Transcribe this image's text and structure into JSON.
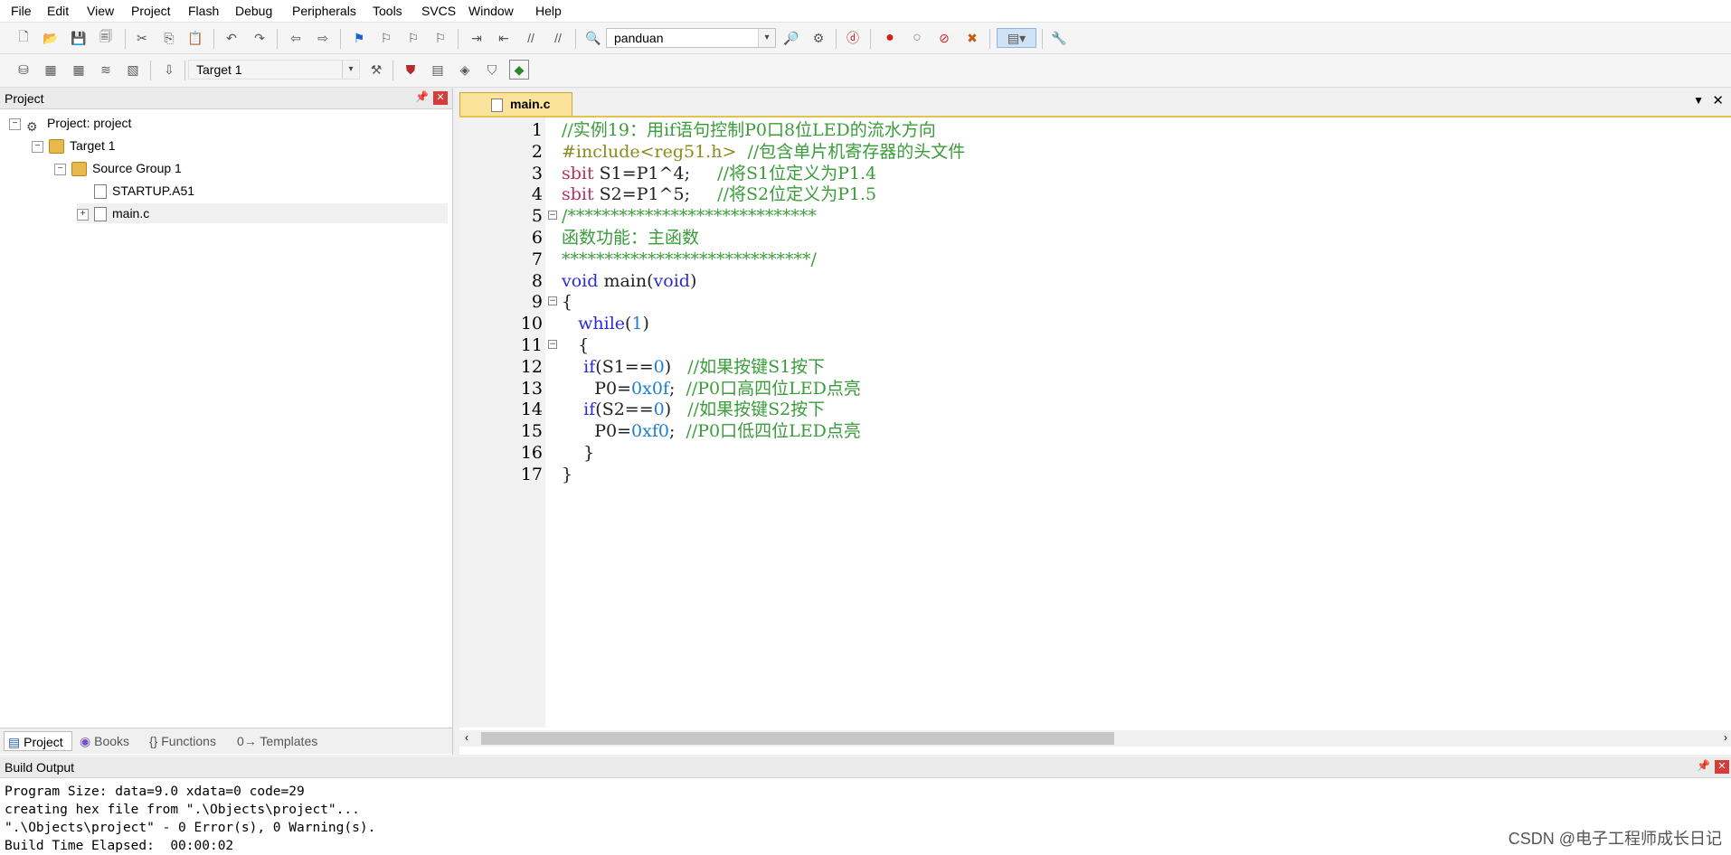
{
  "menu": [
    "File",
    "Edit",
    "View",
    "Project",
    "Flash",
    "Debug",
    "Peripherals",
    "Tools",
    "SVCS",
    "Window",
    "Help"
  ],
  "toolbar1": {
    "find_combo": "panduan"
  },
  "toolbar2": {
    "target_combo": "Target 1"
  },
  "project_panel": {
    "title": "Project",
    "tree": [
      "Project: project",
      "Target 1",
      "Source Group 1",
      "STARTUP.A51",
      "main.c"
    ],
    "bottom_tabs": [
      "Project",
      "Books",
      "{} Functions",
      "0→ Templates"
    ]
  },
  "editor": {
    "tab": "main.c",
    "lines": [
      [
        {
          "t": "c",
          "s": "//实例19：用if语句控制P0口8位LED的流水方向"
        }
      ],
      [
        {
          "t": "p",
          "s": "#include<reg51.h>"
        },
        {
          "t": "n",
          "s": "  "
        },
        {
          "t": "c",
          "s": "//包含单片机寄存器的头文件"
        }
      ],
      [
        {
          "t": "y",
          "s": "sbit"
        },
        {
          "t": "n",
          "s": " S1=P1^4;     "
        },
        {
          "t": "c",
          "s": "//将S1位定义为P1.4"
        }
      ],
      [
        {
          "t": "y",
          "s": "sbit"
        },
        {
          "t": "n",
          "s": " S2=P1^5;     "
        },
        {
          "t": "c",
          "s": "//将S2位定义为P1.5"
        }
      ],
      [
        {
          "t": "c",
          "s": "/*****************************"
        }
      ],
      [
        {
          "t": "c",
          "s": "函数功能：主函数"
        }
      ],
      [
        {
          "t": "c",
          "s": "*****************************/"
        }
      ],
      [
        {
          "t": "k",
          "s": "void"
        },
        {
          "t": "n",
          "s": " main("
        },
        {
          "t": "k",
          "s": "void"
        },
        {
          "t": "n",
          "s": ")"
        }
      ],
      [
        {
          "t": "n",
          "s": "{"
        }
      ],
      [
        {
          "t": "n",
          "s": "   "
        },
        {
          "t": "k",
          "s": "while"
        },
        {
          "t": "n",
          "s": "("
        },
        {
          "t": "d",
          "s": "1"
        },
        {
          "t": "n",
          "s": ")"
        }
      ],
      [
        {
          "t": "n",
          "s": "   {"
        }
      ],
      [
        {
          "t": "n",
          "s": "    "
        },
        {
          "t": "k",
          "s": "if"
        },
        {
          "t": "n",
          "s": "(S1=="
        },
        {
          "t": "d",
          "s": "0"
        },
        {
          "t": "n",
          "s": ")   "
        },
        {
          "t": "c",
          "s": "//如果按键S1按下"
        }
      ],
      [
        {
          "t": "n",
          "s": "      P0="
        },
        {
          "t": "d",
          "s": "0x0f"
        },
        {
          "t": "n",
          "s": ";  "
        },
        {
          "t": "c",
          "s": "//P0口高四位LED点亮"
        }
      ],
      [
        {
          "t": "n",
          "s": "    "
        },
        {
          "t": "k",
          "s": "if"
        },
        {
          "t": "n",
          "s": "(S2=="
        },
        {
          "t": "d",
          "s": "0"
        },
        {
          "t": "n",
          "s": ")   "
        },
        {
          "t": "c",
          "s": "//如果按键S2按下"
        }
      ],
      [
        {
          "t": "n",
          "s": "      P0="
        },
        {
          "t": "d",
          "s": "0xf0"
        },
        {
          "t": "n",
          "s": ";  "
        },
        {
          "t": "c",
          "s": "//P0口低四位LED点亮"
        }
      ],
      [
        {
          "t": "n",
          "s": "    }"
        }
      ],
      [
        {
          "t": "n",
          "s": "}"
        }
      ]
    ],
    "line_numbers": [
      "1",
      "2",
      "3",
      "4",
      "5",
      "6",
      "7",
      "8",
      "9",
      "10",
      "11",
      "12",
      "13",
      "14",
      "15",
      "16",
      "17"
    ],
    "fold_lines": [
      5,
      9,
      11
    ]
  },
  "build_output": {
    "title": "Build Output",
    "lines": [
      "Program Size: data=9.0 xdata=0 code=29",
      "creating hex file from \".\\Objects\\project\"...",
      "\".\\Objects\\project\" - 0 Error(s), 0 Warning(s).",
      "Build Time Elapsed:  00:00:02"
    ]
  },
  "watermark": "CSDN @电子工程师成长日记",
  "colors": {
    "comment": "#3a9c3a",
    "keyword": "#2b2bd6",
    "number": "#1b7fd1",
    "type": "#b1335c",
    "preprocessor": "#8a8a1d",
    "tab_active": "#fbe39b"
  }
}
